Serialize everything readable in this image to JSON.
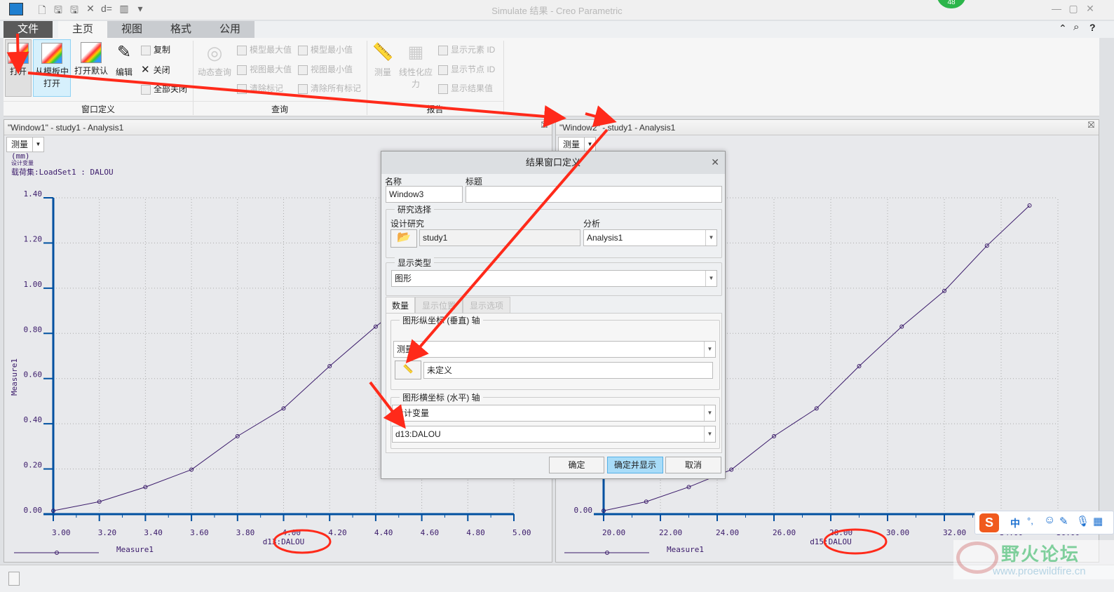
{
  "app": {
    "title": "Simulate 结果 - Creo Parametric",
    "badge": "48"
  },
  "quick_access": [
    "new-icon",
    "save-icon",
    "save-as-icon",
    "close-icon",
    "regenerate-icon",
    "window-icon",
    "more-icon"
  ],
  "tabs": [
    {
      "label": "文件"
    },
    {
      "label": "主页"
    },
    {
      "label": "视图"
    },
    {
      "label": "格式"
    },
    {
      "label": "公用"
    }
  ],
  "ribbon": {
    "window_def": {
      "label": "窗口定义",
      "open": "打开",
      "from_template_1": "从模板中",
      "from_template_2": "打开",
      "open_default": "打开默认",
      "edit": "编辑",
      "copy": "复制",
      "close": "关闭",
      "close_all": "全部关闭"
    },
    "query": {
      "label": "查询",
      "dynamic_query": "动态查询",
      "model_max": "模型最大值",
      "model_min": "模型最小值",
      "view_max": "视图最大值",
      "view_min": "视图最小值",
      "clear_marks": "清除标记",
      "clear_all_marks": "清除所有标记"
    },
    "report": {
      "label": "报告",
      "measure": "测量",
      "linearized_1": "线性化应",
      "linearized_2": "力",
      "show_element_id": "显示元素 ID",
      "show_node_id": "显示节点 ID",
      "show_result_values": "显示结果值"
    }
  },
  "windows": [
    {
      "title": "\"Window1\" - study1 - Analysis1",
      "selector": "测量",
      "unit": "(mm)",
      "design_var": "设计变量",
      "loadset": "载荷集:LoadSet1 :  DALOU",
      "legend": "Measure1"
    },
    {
      "title": "\"Window2\" - study1 - Analysis1",
      "selector": "测量",
      "legend": "Measure1"
    }
  ],
  "dialog": {
    "title": "结果窗口定义",
    "name_label": "名称",
    "name_value": "Window3",
    "title_label": "标题",
    "title_value": "",
    "study_group": "研究选择",
    "design_study_label": "设计研究",
    "design_study_value": "study1",
    "analysis_label": "分析",
    "analysis_value": "Analysis1",
    "display_type_group": "显示类型",
    "display_type_value": "图形",
    "tabs": [
      "数量",
      "显示位置",
      "显示选项"
    ],
    "y_axis_group": "图形纵坐标 (垂直) 轴",
    "y_axis_value": "测量",
    "y_measure_value": "未定义",
    "x_axis_group": "图形横坐标 (水平) 轴",
    "x_axis_value": "设计变量",
    "x_var_value": "d13:DALOU",
    "ok": "确定",
    "ok_show": "确定并显示",
    "cancel": "取消"
  },
  "ime": {
    "lang": "中",
    "punct": "°,"
  },
  "watermark": {
    "title": "野火论坛",
    "url": "www.proewildfire.cn"
  },
  "colors": {
    "axis": "#0050a0",
    "series": "#3a1a6a",
    "annotation": "#ff2a1a"
  },
  "chart_data": [
    {
      "type": "line",
      "title": "",
      "xlabel": "d13:DALOU",
      "ylabel": "Measure1",
      "xlim": [
        3.0,
        5.0
      ],
      "ylim": [
        0,
        1.4
      ],
      "grid": true,
      "legend": "bottom-left",
      "xticks": [
        "3.00",
        "3.20",
        "3.40",
        "3.60",
        "3.80",
        "4.00",
        "4.20",
        "4.40",
        "4.60",
        "4.80",
        "5.00"
      ],
      "yticks": [
        "0.00",
        "0.20",
        "0.40",
        "0.60",
        "0.80",
        "1.00",
        "1.20",
        "1.40"
      ],
      "series": [
        {
          "name": "Measure1",
          "x": [
            3.0,
            3.2,
            3.4,
            3.6,
            3.8,
            4.0,
            4.2,
            4.4,
            4.6,
            4.8,
            5.0
          ],
          "y": [
            0.015,
            0.055,
            0.12,
            0.197,
            0.345,
            0.468,
            0.655,
            0.83,
            0.988,
            1.188,
            1.366
          ]
        }
      ]
    },
    {
      "type": "line",
      "title": "",
      "xlabel": "d15:DALOU",
      "ylabel": "Measure1",
      "xlim": [
        20,
        36
      ],
      "ylim": [
        0,
        1.4
      ],
      "grid": true,
      "legend": "bottom-left",
      "xticks": [
        "20.00",
        "22.00",
        "24.00",
        "26.00",
        "28.00",
        "30.00",
        "32.00",
        "34.00",
        "36.00"
      ],
      "yticks": [
        "0.00",
        "0.20",
        "0.40",
        "0.60",
        "0.80",
        "1.00",
        "1.20",
        "1.40"
      ],
      "series": [
        {
          "name": "Measure1",
          "x": [
            20,
            21.5,
            23,
            24.5,
            26,
            27.5,
            29,
            30.5,
            32,
            33.5,
            35
          ],
          "y": [
            0.015,
            0.055,
            0.12,
            0.197,
            0.345,
            0.468,
            0.655,
            0.83,
            0.988,
            1.188,
            1.366
          ]
        }
      ]
    }
  ]
}
